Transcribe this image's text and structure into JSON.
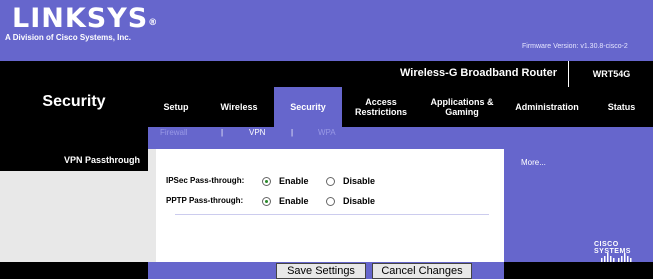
{
  "brand": {
    "logo_text": "LINKSYS",
    "registered_mark": "®",
    "subtitle": "A Division of Cisco Systems, Inc.",
    "firmware": "Firmware Version: v1.30.8-cisco-2"
  },
  "product": {
    "name": "Wireless-G Broadband Router",
    "model": "WRT54G"
  },
  "section_title": "Security",
  "tabs": [
    {
      "label": "Setup"
    },
    {
      "label": "Wireless"
    },
    {
      "label": "Security",
      "active": true
    },
    {
      "label": "Access Restrictions"
    },
    {
      "label": "Applications & Gaming"
    },
    {
      "label": "Administration"
    },
    {
      "label": "Status"
    }
  ],
  "subtabs": [
    {
      "label": "Firewall"
    },
    {
      "label": "VPN",
      "active": true
    },
    {
      "label": "WPA"
    }
  ],
  "subtab_separator": "|",
  "sidebar": {
    "heading": "VPN Passthrough"
  },
  "vpn": {
    "rows": [
      {
        "label": "IPSec Pass-through:",
        "value": "Enable"
      },
      {
        "label": "PPTP Pass-through:",
        "value": "Enable"
      }
    ],
    "options": [
      "Enable",
      "Disable"
    ]
  },
  "help": {
    "more_link": "More..."
  },
  "cisco": {
    "text": "Cisco Systems",
    "icon": "cisco-bridge-logo"
  },
  "buttons": {
    "save": "Save Settings",
    "cancel": "Cancel Changes"
  },
  "colors": {
    "brand_purple": "#6666cc",
    "black": "#000000",
    "selected_radio": "#2a8a2a"
  }
}
